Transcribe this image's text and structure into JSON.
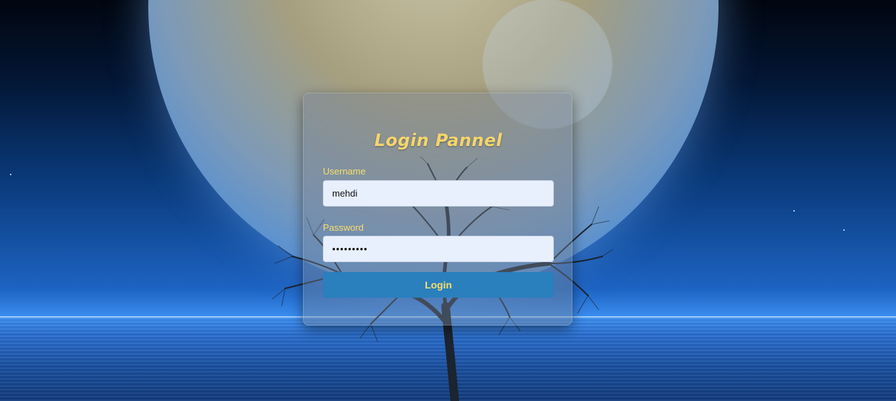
{
  "login_panel": {
    "title": "Login Pannel",
    "username_label": "Username",
    "username_value": "mehdi",
    "password_label": "Password",
    "password_value": "mehdi1234",
    "login_button": "Login"
  },
  "colors": {
    "title": "#f4d56c",
    "label": "#f8df6a",
    "button": "#2a7fbd",
    "input_background": "#e8f0fe"
  },
  "icons": [
    "moon-illustration",
    "tree-illustration"
  ]
}
